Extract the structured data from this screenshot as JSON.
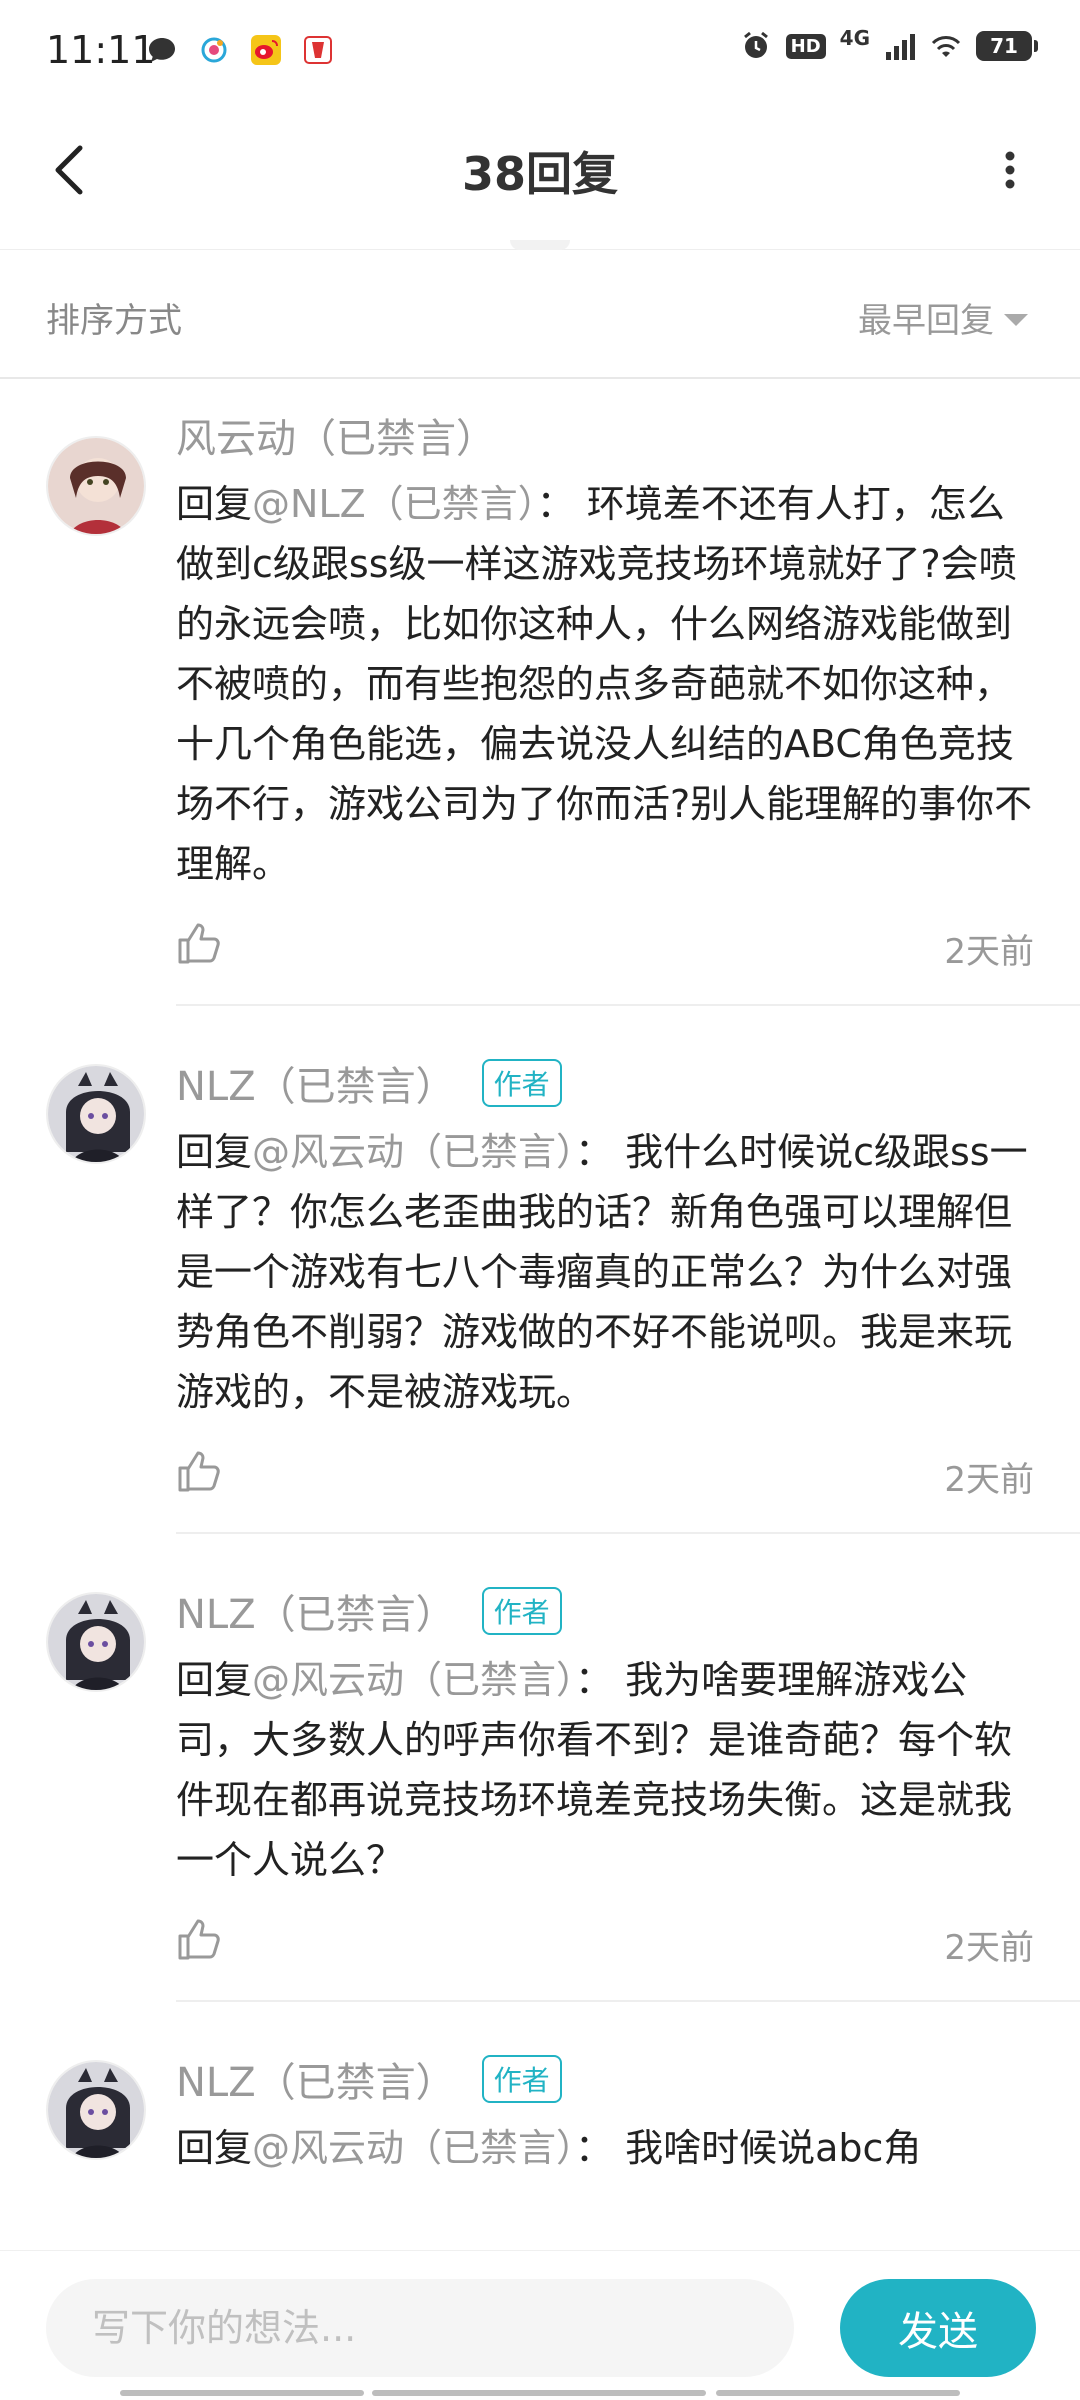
{
  "status_bar": {
    "time": "11:11",
    "network": "4G",
    "hd": "HD",
    "battery": "71"
  },
  "header": {
    "title": "38回复"
  },
  "sort": {
    "label": "排序方式",
    "selected": "最早回复"
  },
  "comments": [
    {
      "author": "风云动（已禁言）",
      "is_author": false,
      "prefix": "回复",
      "mention": "@NLZ（已禁言）",
      "text": "： 环境差不还有人打，怎么做到c级跟ss级一样这游戏竞技场环境就好了?会喷的永远会喷，比如你这种人，什么网络游戏能做到不被喷的，而有些抱怨的点多奇葩就不如你这种，十几个角色能选，偏去说没人纠结的ABC角色竞技场不行，游戏公司为了你而活?别人能理解的事你不理解。",
      "time": "2天前"
    },
    {
      "author": "NLZ（已禁言）",
      "is_author": true,
      "badge": "作者",
      "prefix": "回复",
      "mention": "@风云动（已禁言）",
      "text": "： 我什么时候说c级跟ss一样了？你怎么老歪曲我的话？新角色强可以理解但是一个游戏有七八个毒瘤真的正常么？为什么对强势角色不削弱？游戏做的不好不能说呗。我是来玩游戏的，不是被游戏玩。",
      "time": "2天前"
    },
    {
      "author": "NLZ（已禁言）",
      "is_author": true,
      "badge": "作者",
      "prefix": "回复",
      "mention": "@风云动（已禁言）",
      "text": "： 我为啥要理解游戏公司，大多数人的呼声你看不到？是谁奇葩？每个软件现在都再说竞技场环境差竞技场失衡。这是就我一个人说么？",
      "time": "2天前"
    },
    {
      "author": "NLZ（已禁言）",
      "is_author": true,
      "badge": "作者",
      "prefix": "回复",
      "mention": "@风云动（已禁言）",
      "text": "： 我啥时候说abc角",
      "time": ""
    }
  ],
  "input": {
    "placeholder": "写下你的想法...",
    "send_label": "发送"
  },
  "colors": {
    "accent": "#21b3c4",
    "muted_text": "#999999",
    "body_text": "#222222"
  }
}
